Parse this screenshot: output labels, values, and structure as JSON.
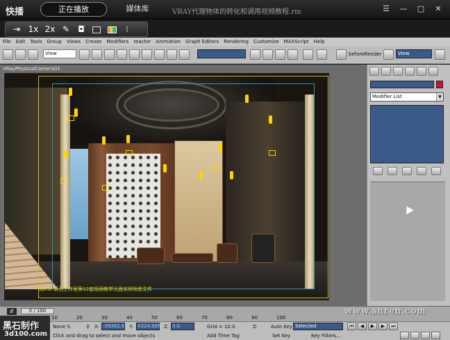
{
  "player": {
    "app_name": "快播",
    "tabs": [
      {
        "label": "正在播放"
      },
      {
        "label": "媒体库"
      }
    ],
    "title": "VRAY代理物体的转化和调用视频教程.rm",
    "speed_options": [
      "1x",
      "2x"
    ]
  },
  "max": {
    "menu": [
      "File",
      "Edit",
      "Tools",
      "Group",
      "Views",
      "Create",
      "Modifiers",
      "reactor",
      "Animation",
      "Graph Editors",
      "Rendering",
      "Customize",
      "MAXScript",
      "Help"
    ],
    "view_dropdown": "View",
    "render_preset": "beforeRender",
    "render_view": "View",
    "viewport_label": "VRayPhysicalCamera01",
    "scene_caption": "Spiral 黄石工作室第12套视频教学光盘实例场景文件",
    "modifier_list": "Modifier List",
    "timeline": {
      "frame_display": "0 / 100",
      "ticks": [
        "0",
        "10",
        "20",
        "30",
        "40",
        "50",
        "60",
        "70",
        "80",
        "90",
        "100"
      ]
    },
    "status": {
      "selection": "None S",
      "x_label": "X:",
      "x_value": "-39362.676",
      "y_label": "Y:",
      "y_value": "4324.986",
      "z_label": "Z:",
      "z_value": "0.0",
      "grid": "Grid = 10.0",
      "auto_key": "Auto Key",
      "selected": "Selected",
      "set_key": "Set Key",
      "key_filters": "Key Filters...",
      "prompt": "Click and drag to select and move objects",
      "add_time_tag": "Add Time Tag",
      "frame": "0"
    }
  },
  "watermarks": {
    "left_line1": "黑石制作",
    "left_line2": "3d100.com",
    "right": "www.snren.com"
  },
  "colors": {
    "viewport_bg": "#6d6d6d",
    "panel_blue": "#3a5a8a",
    "render_frame": "#c8c020",
    "safe_frame": "#2a9ab0",
    "object_color": "#c0173a"
  }
}
